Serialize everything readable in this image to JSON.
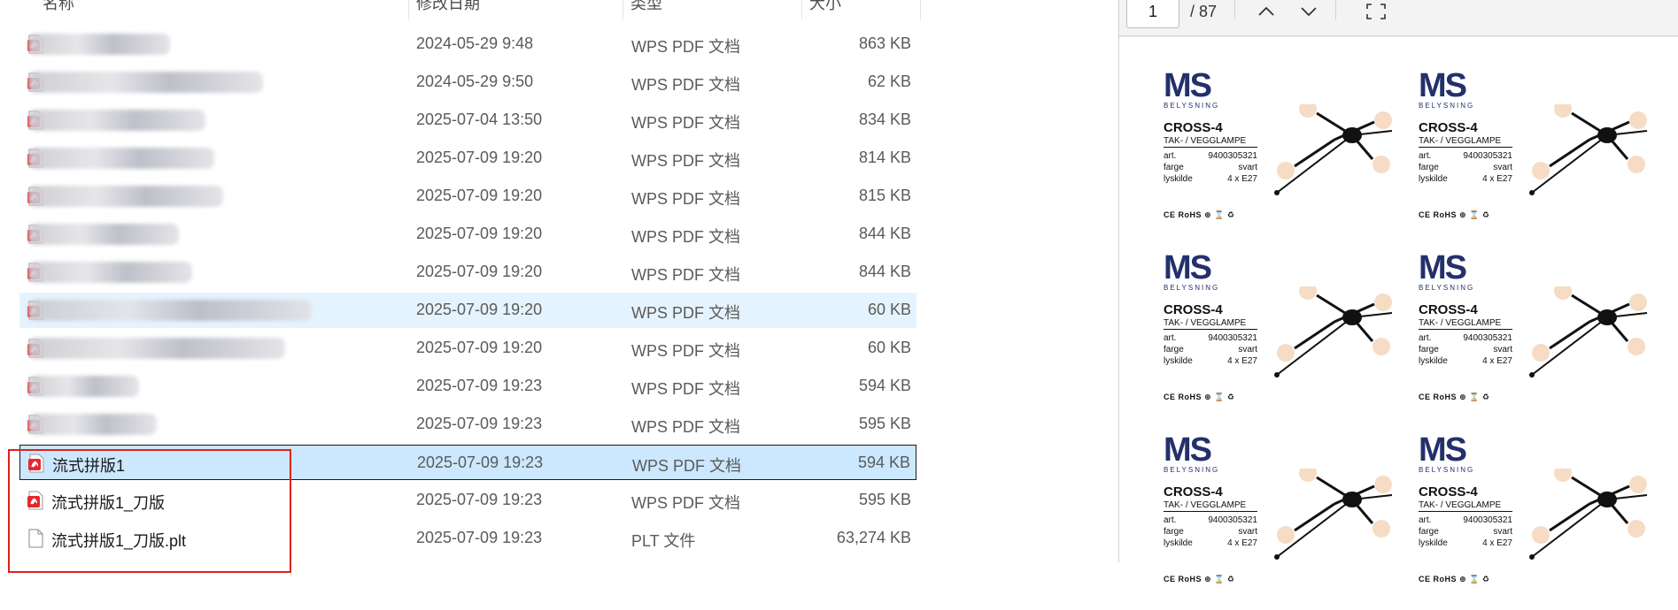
{
  "file_list": {
    "columns": {
      "name": "名称",
      "date": "修改日期",
      "type": "类型",
      "size": "大小"
    },
    "rows": [
      {
        "name": "",
        "date": "2024-05-29 9:48",
        "type": "WPS PDF 文档",
        "size": "863 KB",
        "icon": "pdf-icon",
        "blurred": true
      },
      {
        "name": "",
        "date": "2024-05-29 9:50",
        "type": "WPS PDF 文档",
        "size": "62 KB",
        "icon": "pdf-icon",
        "blurred": true
      },
      {
        "name": "",
        "date": "2025-07-04 13:50",
        "type": "WPS PDF 文档",
        "size": "834 KB",
        "icon": "pdf-icon",
        "blurred": true
      },
      {
        "name": "",
        "date": "2025-07-09 19:20",
        "type": "WPS PDF 文档",
        "size": "814 KB",
        "icon": "pdf-icon",
        "blurred": true
      },
      {
        "name": "",
        "date": "2025-07-09 19:20",
        "type": "WPS PDF 文档",
        "size": "815 KB",
        "icon": "pdf-icon",
        "blurred": true
      },
      {
        "name": "",
        "date": "2025-07-09 19:20",
        "type": "WPS PDF 文档",
        "size": "844 KB",
        "icon": "pdf-icon",
        "blurred": true
      },
      {
        "name": "",
        "date": "2025-07-09 19:20",
        "type": "WPS PDF 文档",
        "size": "844 KB",
        "icon": "pdf-icon",
        "blurred": true
      },
      {
        "name": "",
        "date": "2025-07-09 19:20",
        "type": "WPS PDF 文档",
        "size": "60 KB",
        "icon": "pdf-icon",
        "blurred": true,
        "state": "hover"
      },
      {
        "name": "",
        "date": "2025-07-09 19:20",
        "type": "WPS PDF 文档",
        "size": "60 KB",
        "icon": "pdf-icon",
        "blurred": true
      },
      {
        "name": "",
        "date": "2025-07-09 19:23",
        "type": "WPS PDF 文档",
        "size": "594 KB",
        "icon": "pdf-icon",
        "blurred": true
      },
      {
        "name": "",
        "date": "2025-07-09 19:23",
        "type": "WPS PDF 文档",
        "size": "595 KB",
        "icon": "pdf-icon",
        "blurred": true
      },
      {
        "name": "流式拼版1",
        "date": "2025-07-09 19:23",
        "type": "WPS PDF 文档",
        "size": "594 KB",
        "icon": "pdf-icon",
        "blurred": false,
        "state": "selected"
      },
      {
        "name": "流式拼版1_刀版",
        "date": "2025-07-09 19:23",
        "type": "WPS PDF 文档",
        "size": "595 KB",
        "icon": "pdf-icon",
        "blurred": false
      },
      {
        "name": "流式拼版1_刀版.plt",
        "date": "2025-07-09 19:23",
        "type": "PLT 文件",
        "size": "63,274 KB",
        "icon": "plt-file-icon",
        "blurred": false
      }
    ]
  },
  "viewer": {
    "page_current": "1",
    "page_total": "/ 87",
    "label": {
      "brand": "MS",
      "brand_sub": "BELYSNING",
      "product": "CROSS-4",
      "subtitle": "TAK- / VEGGLAMPE",
      "specs": [
        {
          "k": "art.",
          "v": "9400305321"
        },
        {
          "k": "farge",
          "v": "svart"
        },
        {
          "k": "lyskilde",
          "v": "4 x E27"
        }
      ],
      "cert": "CE RoHS"
    }
  }
}
